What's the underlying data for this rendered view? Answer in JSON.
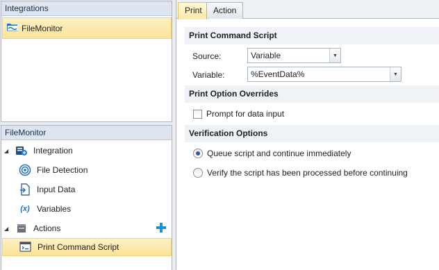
{
  "integrations_panel": {
    "header": "Integrations",
    "items": [
      {
        "label": "FileMonitor",
        "icon": "folder-monitor-icon",
        "selected": true
      }
    ]
  },
  "tree_panel": {
    "header": "FileMonitor",
    "integration": {
      "label": "Integration",
      "icon": "integration-icon",
      "children": [
        {
          "label": "File Detection",
          "icon": "file-detection-icon"
        },
        {
          "label": "Input Data",
          "icon": "input-data-icon"
        },
        {
          "label": "Variables",
          "icon": "variables-icon"
        }
      ]
    },
    "actions": {
      "label": "Actions",
      "icon": "actions-icon",
      "add_icon": "plus-icon",
      "children": [
        {
          "label": "Print Command Script",
          "icon": "print-script-icon",
          "selected": true
        }
      ]
    }
  },
  "tabs": [
    {
      "label": "Print",
      "active": true
    },
    {
      "label": "Action",
      "active": false
    }
  ],
  "print_command_script": {
    "title": "Print Command Script",
    "source_label": "Source:",
    "source_value": "Variable",
    "variable_label": "Variable:",
    "variable_value": "%EventData%"
  },
  "print_option_overrides": {
    "title": "Print Option Overrides",
    "prompt_label": "Prompt for data input",
    "prompt_checked": false
  },
  "verification_options": {
    "title": "Verification Options",
    "options": [
      {
        "label": "Queue script and continue immediately",
        "selected": true
      },
      {
        "label": "Verify the script has been processed before continuing",
        "selected": false
      }
    ]
  },
  "colors": {
    "selection_bg": "#fbe397",
    "panel_header_bg": "#dde6f0",
    "section_header_bg": "#eff2f6",
    "accent_plus": "#1b8fd8",
    "border": "#a9b5c3"
  }
}
